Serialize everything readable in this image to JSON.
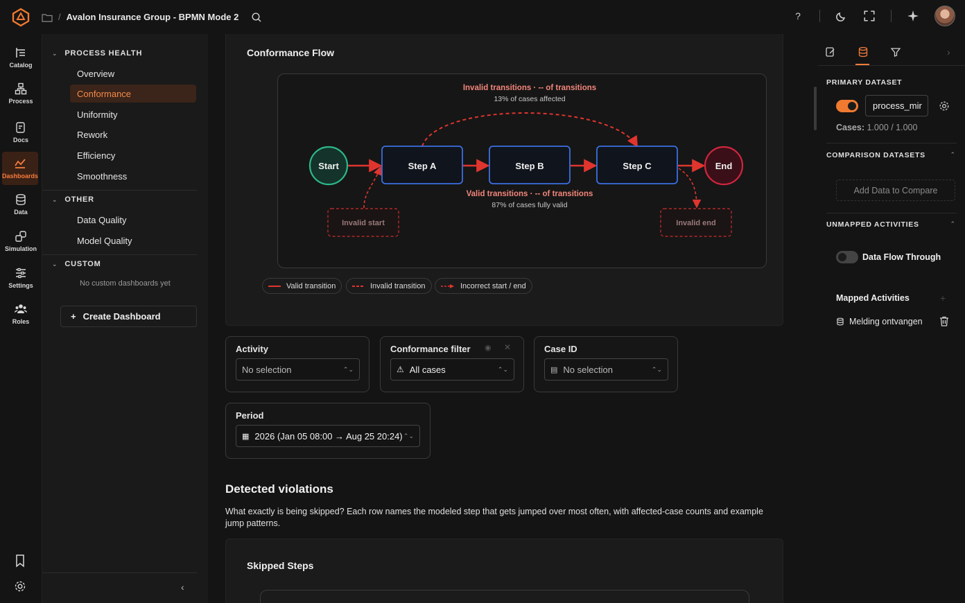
{
  "topbar": {
    "breadcrumb_title": "Avalon Insurance Group - BPMN Mode 2",
    "breadcrumb_sep": "/"
  },
  "rail": {
    "items": [
      {
        "label": "Catalog",
        "icon": "catalog-icon"
      },
      {
        "label": "Process",
        "icon": "process-icon"
      },
      {
        "label": "Docs",
        "icon": "docs-icon"
      },
      {
        "label": "Dashboards",
        "icon": "dashboards-icon"
      },
      {
        "label": "Data",
        "icon": "database-icon"
      },
      {
        "label": "Simulation",
        "icon": "simulation-icon"
      },
      {
        "label": "Settings",
        "icon": "sliders-icon"
      },
      {
        "label": "Roles",
        "icon": "users-icon"
      }
    ]
  },
  "sidebar": {
    "process_health": {
      "title": "PROCESS HEALTH",
      "items": [
        "Overview",
        "Conformance",
        "Uniformity",
        "Rework",
        "Efficiency",
        "Smoothness"
      ],
      "active": "Conformance"
    },
    "other": {
      "title": "OTHER",
      "items": [
        "Data Quality",
        "Model Quality"
      ]
    },
    "custom": {
      "title": "CUSTOM",
      "empty_text": "No custom dashboards yet"
    },
    "create_label": "Create Dashboard"
  },
  "conformance": {
    "title": "Conformance Flow",
    "invalid_title": "Invalid transitions · -- of transitions",
    "invalid_sub": "13% of cases affected",
    "valid_title": "Valid transitions · -- of transitions",
    "valid_sub": "87% of cases fully valid",
    "nodes": {
      "start": "Start",
      "step_a": "Step A",
      "step_b": "Step B",
      "step_c": "Step C",
      "end": "End",
      "invalid_start": "Invalid start",
      "invalid_end": "Invalid end"
    },
    "legend": [
      "Valid transition",
      "Invalid transition",
      "Incorrect start / end"
    ],
    "colors": {
      "valid": "#e0352e",
      "start": "#2db88a",
      "end": "#d0263e",
      "node_border": "#3b6fe0"
    }
  },
  "filters": {
    "activity": {
      "label": "Activity",
      "value": "No selection"
    },
    "conformance": {
      "label": "Conformance filter",
      "value": "All cases"
    },
    "case_id": {
      "label": "Case ID",
      "value": "No selection"
    },
    "period": {
      "label": "Period",
      "value": "2026 (Jan 05 08:00 → Aug 25 20:24)"
    }
  },
  "violations": {
    "heading": "Detected violations",
    "description": "What exactly is being skipped? Each row names the modeled step that gets jumped over most often, with affected-case counts and example jump patterns.",
    "skipped_title": "Skipped Steps"
  },
  "rpanel": {
    "primary_label": "PRIMARY DATASET",
    "dataset_name": "process_mir",
    "cases_label": "Cases:",
    "cases_value": "1.000 / 1.000",
    "comparison_label": "COMPARISON DATASETS",
    "add_compare": "Add Data to Compare",
    "unmapped_label": "UNMAPPED ACTIVITIES",
    "data_flow": "Data Flow Through",
    "mapped_label": "Mapped Activities",
    "mapped_item": "Melding ontvangen"
  }
}
